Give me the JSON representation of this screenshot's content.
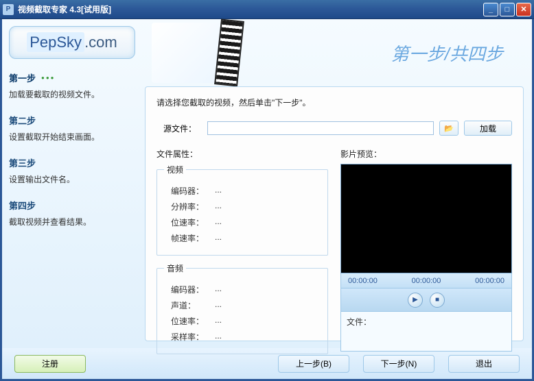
{
  "window": {
    "title": "视频截取专家  4.3[试用版]"
  },
  "logo": {
    "brand": "PepSky",
    "domain": ".com"
  },
  "sidebar": {
    "steps": [
      {
        "title": "第一步",
        "desc": "加载要截取的视频文件。",
        "active": true
      },
      {
        "title": "第二步",
        "desc": "设置截取开始结束画面。",
        "active": false
      },
      {
        "title": "第三步",
        "desc": "设置输出文件名。",
        "active": false
      },
      {
        "title": "第四步",
        "desc": "截取视频并查看结果。",
        "active": false
      }
    ]
  },
  "banner": {
    "title": "第一步/共四步"
  },
  "main": {
    "instruction": "请选择您截取的视频，然后单击\"下一步\"。",
    "source_label": "源文件：",
    "source_value": "",
    "load_button": "加载",
    "props_label": "文件属性：",
    "video_legend": "视频",
    "audio_legend": "音频",
    "video_props": [
      {
        "k": "编码器：",
        "v": "..."
      },
      {
        "k": "分辨率：",
        "v": "..."
      },
      {
        "k": "位速率：",
        "v": "..."
      },
      {
        "k": "帧速率：",
        "v": "..."
      }
    ],
    "audio_props": [
      {
        "k": "编码器：",
        "v": "..."
      },
      {
        "k": "声道：",
        "v": "..."
      },
      {
        "k": "位速率：",
        "v": "..."
      },
      {
        "k": "采样率：",
        "v": "..."
      }
    ],
    "preview_label": "影片预览：",
    "times": {
      "start": "00:00:00",
      "current": "00:00:00",
      "end": "00:00:00"
    },
    "file_label": "文件："
  },
  "footer": {
    "register": "注册",
    "prev": "上一步(B)",
    "next": "下一步(N)",
    "exit": "退出"
  }
}
